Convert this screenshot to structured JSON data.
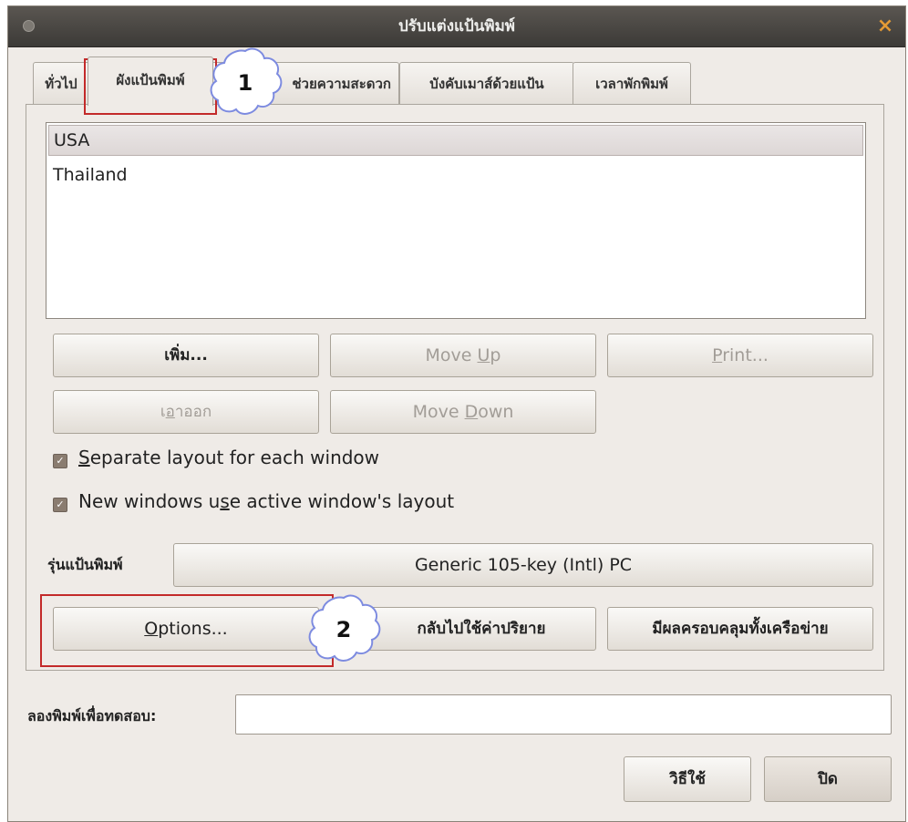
{
  "window": {
    "title": "ปรับแต่งแป้นพิมพ์",
    "close_glyph": "×"
  },
  "tabs": [
    {
      "label": "ทั่วไป",
      "active": false
    },
    {
      "label": "ผังแป้นพิมพ์",
      "active": true
    },
    {
      "label": "ช่วยความสะดวก",
      "active": false
    },
    {
      "label": "บังคับเมาส์ด้วยแป้น",
      "active": false
    },
    {
      "label": "เวลาพักพิมพ์",
      "active": false
    }
  ],
  "layouts": {
    "items": [
      "USA",
      "Thailand"
    ],
    "selected_index": 0
  },
  "buttons": {
    "add": "เพิ่ม...",
    "move_up_pre": "Move ",
    "move_up_key": "U",
    "move_up_post": "p",
    "print_key": "P",
    "print_post": "rint...",
    "remove_pre": "เ",
    "remove_key": "อ",
    "remove_post": "าออก",
    "move_down_pre": "Move ",
    "move_down_key": "D",
    "move_down_post": "own",
    "options_key": "O",
    "options_post": "ptions...",
    "reset_defaults": "กลับไปใช้ค่าปริยาย",
    "apply_system_wide": "มีผลครอบคลุมทั้งเครือข่าย",
    "help": "วิธีใช้",
    "close": "ปิด"
  },
  "checkboxes": {
    "separate_layout": {
      "key": "S",
      "rest": "eparate layout for each window",
      "checked": true
    },
    "new_windows": {
      "pre": "New windows u",
      "key": "s",
      "rest": "e active window's layout",
      "checked": true
    }
  },
  "keyboard_model": {
    "label": "รุ่นแป้นพิมพ์",
    "value": "Generic 105-key (Intl) PC"
  },
  "test_field": {
    "label": "ลองพิมพ์เพื่อทดสอบ:",
    "value": ""
  },
  "annotations": {
    "callout_1": "1",
    "callout_2": "2",
    "highlight_color": "#c32a2a"
  },
  "colors": {
    "titlebar": "#3c3a37",
    "window_bg": "#efebe7",
    "close_icon": "#e49a35"
  }
}
